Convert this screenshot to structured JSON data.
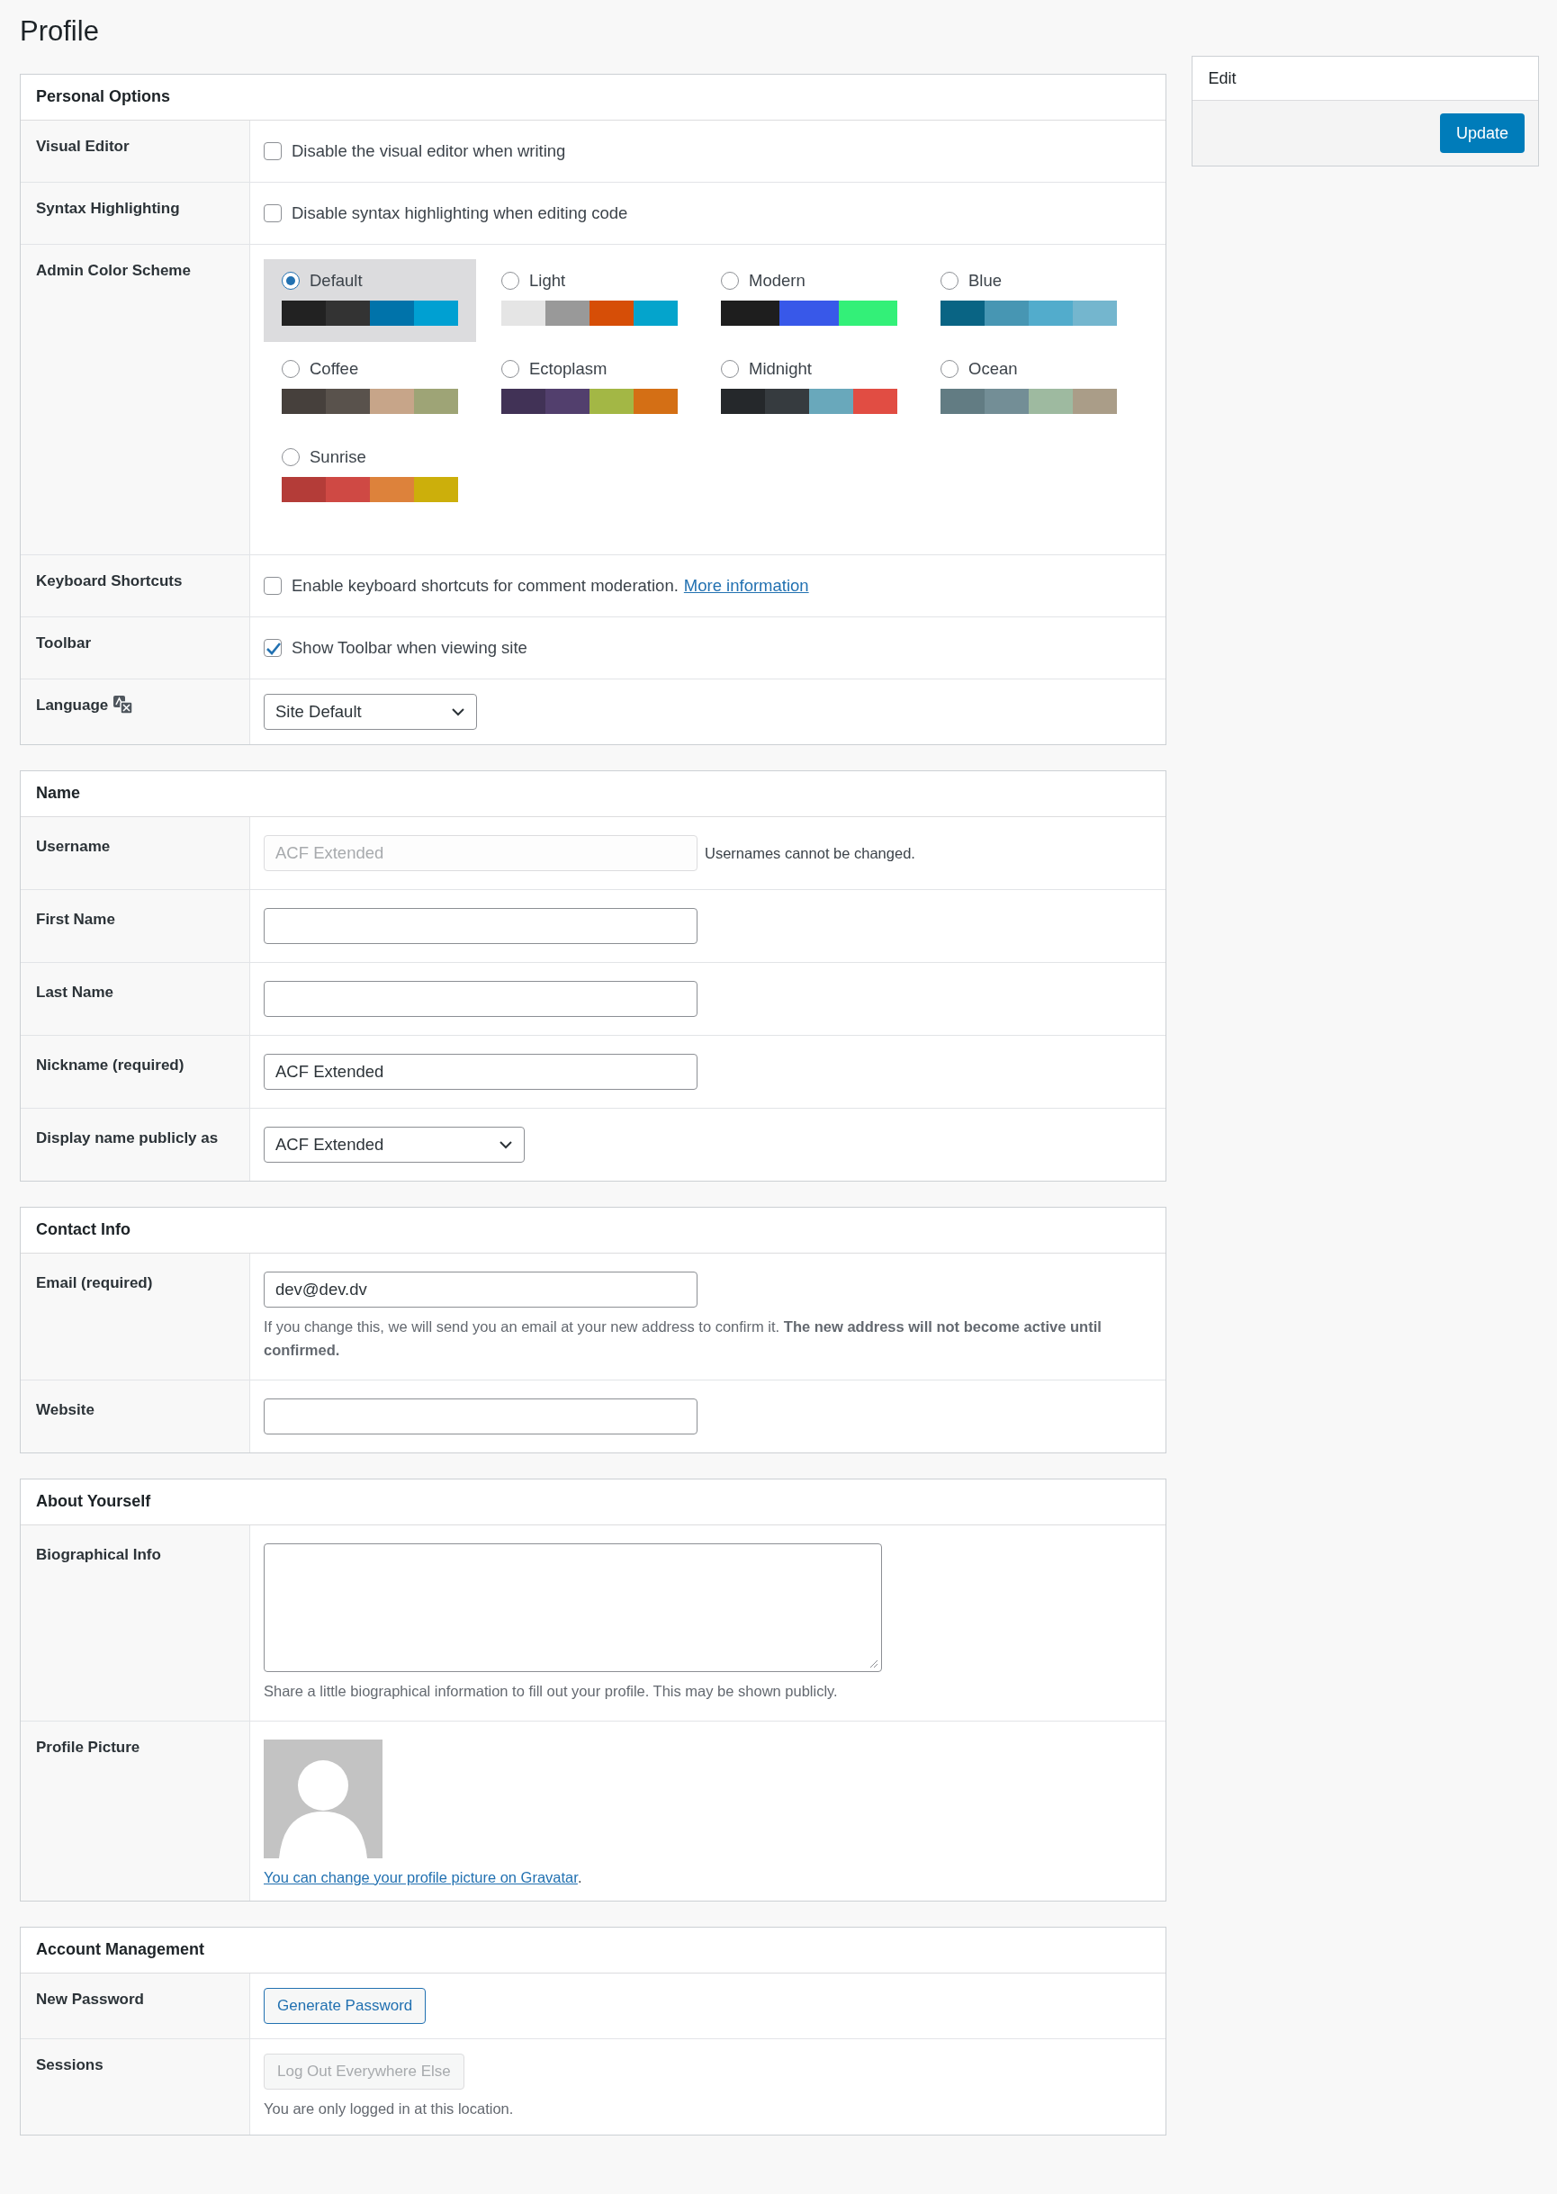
{
  "page_title": "Profile",
  "sections": [
    {
      "title": "Personal Options",
      "rows": [
        {
          "label": "Visual Editor",
          "kind": "checkbox",
          "checked": false,
          "text": "Disable the visual editor when writing"
        },
        {
          "label": "Syntax Highlighting",
          "kind": "checkbox",
          "checked": false,
          "text": "Disable syntax highlighting when editing code"
        },
        {
          "label": "Admin Color Scheme",
          "kind": "schemes",
          "schemes": [
            {
              "name": "Default",
              "selected": true,
              "swatches": [
                {
                  "color": "#222222"
                },
                {
                  "color": "#333333"
                },
                {
                  "color": "#0073aa"
                },
                {
                  "color": "#00a0d2"
                }
              ]
            },
            {
              "name": "Light",
              "selected": false,
              "swatches": [
                {
                  "color": "#e5e5e5"
                },
                {
                  "color": "#999999"
                },
                {
                  "color": "#d64e07"
                },
                {
                  "color": "#04a4cc"
                }
              ]
            },
            {
              "name": "Modern",
              "selected": false,
              "swatches": [
                {
                  "color": "#1e1e1e"
                },
                {
                  "color": "#3858e9"
                },
                {
                  "color": "#33f078"
                }
              ]
            },
            {
              "name": "Blue",
              "selected": false,
              "swatches": [
                {
                  "color": "#096484"
                },
                {
                  "color": "#4796b3"
                },
                {
                  "color": "#52accc"
                },
                {
                  "color": "#74b6ce"
                }
              ]
            },
            {
              "name": "Coffee",
              "selected": false,
              "swatches": [
                {
                  "color": "#46403c"
                },
                {
                  "color": "#59524c"
                },
                {
                  "color": "#c7a589"
                },
                {
                  "color": "#9ea476"
                }
              ]
            },
            {
              "name": "Ectoplasm",
              "selected": false,
              "swatches": [
                {
                  "color": "#413256"
                },
                {
                  "color": "#523f6d"
                },
                {
                  "color": "#a3b745"
                },
                {
                  "color": "#d46f15"
                }
              ]
            },
            {
              "name": "Midnight",
              "selected": false,
              "swatches": [
                {
                  "color": "#25282b"
                },
                {
                  "color": "#363b3f"
                },
                {
                  "color": "#69a8bb"
                },
                {
                  "color": "#e14d43"
                }
              ]
            },
            {
              "name": "Ocean",
              "selected": false,
              "swatches": [
                {
                  "color": "#627c83"
                },
                {
                  "color": "#738e96"
                },
                {
                  "color": "#9ebaa0"
                },
                {
                  "color": "#aa9d88"
                }
              ]
            },
            {
              "name": "Sunrise",
              "selected": false,
              "swatches": [
                {
                  "color": "#b43c38"
                },
                {
                  "color": "#cf4944"
                },
                {
                  "color": "#dd823b"
                },
                {
                  "color": "#ccaf0b"
                }
              ]
            }
          ]
        },
        {
          "label": "Keyboard Shortcuts",
          "kind": "checkbox",
          "checked": false,
          "text": "Enable keyboard shortcuts for comment moderation.",
          "link": "More information"
        },
        {
          "label": "Toolbar",
          "kind": "checkbox",
          "checked": true,
          "text": "Show Toolbar when viewing site"
        },
        {
          "label": "Language",
          "kind": "language_select",
          "value": "Site Default"
        }
      ]
    },
    {
      "title": "Name",
      "rows": [
        {
          "label": "Username",
          "kind": "text",
          "value": "ACF Extended",
          "disabled": true,
          "note": "Usernames cannot be changed."
        },
        {
          "label": "First Name",
          "kind": "text"
        },
        {
          "label": "Last Name",
          "kind": "text"
        },
        {
          "label": "Nickname (required)",
          "kind": "text",
          "value": "ACF Extended"
        },
        {
          "label": "Display name publicly as",
          "kind": "select",
          "value": "ACF Extended"
        }
      ]
    },
    {
      "title": "Contact Info",
      "rows": [
        {
          "label": "Email (required)",
          "kind": "text",
          "value": "dev@dev.dv",
          "description": "If you change this, we will send you an email at your new address to confirm it. **The new address will not become active until confirmed.**"
        },
        {
          "label": "Website",
          "kind": "text"
        }
      ]
    },
    {
      "title": "About Yourself",
      "rows": [
        {
          "label": "Biographical Info",
          "kind": "textarea",
          "description": "Share a little biographical information to fill out your profile. This may be shown publicly."
        },
        {
          "label": "Profile Picture",
          "link": "You can change your profile picture on Gravatar",
          "after": "."
        }
      ]
    },
    {
      "title": "Account Management",
      "rows": [
        {
          "label": "New Password",
          "kind": "button",
          "button": "Generate Password",
          "disabled": false
        },
        {
          "label": "Sessions",
          "kind": "button",
          "button": "Log Out Everywhere Else",
          "disabled": true,
          "description": "You are only logged in at this location."
        }
      ]
    }
  ],
  "sidebar": {
    "title": "Edit",
    "button": "Update"
  }
}
